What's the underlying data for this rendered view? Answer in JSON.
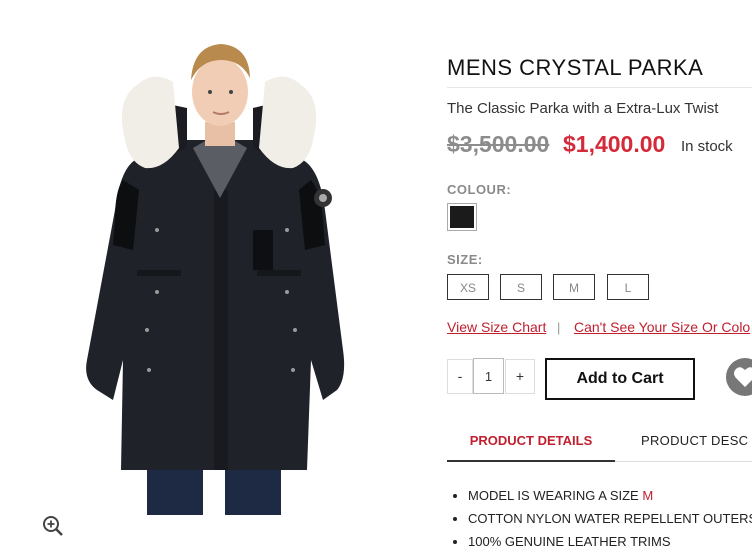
{
  "product": {
    "title": "MENS CRYSTAL PARKA",
    "subtitle": "The Classic Parka with a Extra-Lux Twist",
    "old_price": "$3,500.00",
    "new_price": "$1,400.00",
    "stock": "In stock"
  },
  "colour": {
    "label": "COLOUR:",
    "swatches": [
      {
        "name": "black",
        "color": "#1b1b1b"
      }
    ]
  },
  "size": {
    "label": "SIZE:",
    "options": [
      "XS",
      "S",
      "M",
      "L"
    ]
  },
  "links": {
    "size_chart": "View Size Chart",
    "separator": "|",
    "cant_see": "Can't See Your Size Or Colo"
  },
  "cart": {
    "minus": "-",
    "quantity": "1",
    "plus": "+",
    "add_label": "Add to Cart"
  },
  "tabs": [
    {
      "label": "PRODUCT DETAILS",
      "active": true
    },
    {
      "label": "PRODUCT DESC",
      "active": false
    }
  ],
  "details": [
    {
      "text": "MODEL IS WEARING A SIZE ",
      "highlight": "M"
    },
    {
      "text": "COTTON NYLON WATER REPELLENT OUTERS",
      "highlight": ""
    },
    {
      "text": "100% GENUINE LEATHER TRIMS",
      "highlight": ""
    }
  ],
  "colors": {
    "accent": "#c01f2f",
    "sale_price": "#d42a3a",
    "old_price": "#8c8c8c"
  },
  "icons": [
    "zoom-in-icon",
    "heart-icon"
  ]
}
